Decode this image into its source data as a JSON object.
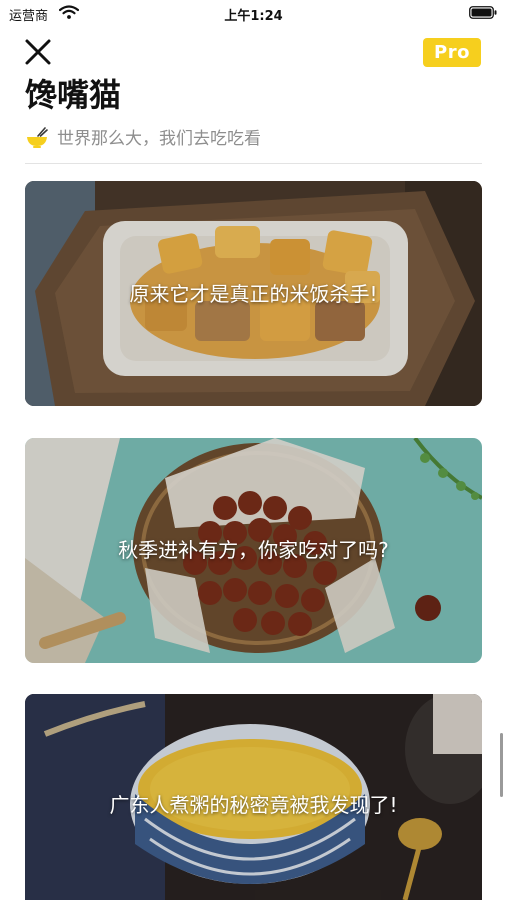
{
  "status_bar": {
    "carrier": "运营商",
    "time": "上午1:24"
  },
  "header": {
    "pro_label": "Pro",
    "title": "馋嘴猫",
    "subtitle": "世界那么大，我们去吃吃看"
  },
  "articles": [
    {
      "title": "原来它才是真正的米饭杀手!"
    },
    {
      "title": "秋季进补有方，你家吃对了吗?"
    },
    {
      "title": "广东人煮粥的秘密竟被我发现了!"
    }
  ],
  "colors": {
    "accent": "#f6cf1e",
    "subtitle_gray": "#8e8e8e"
  }
}
